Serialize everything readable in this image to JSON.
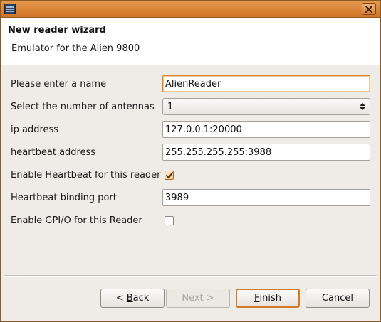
{
  "window": {
    "close_icon": "close-icon",
    "app_icon": "reader-app-icon"
  },
  "header": {
    "title": "New reader wizard",
    "subtitle": "Emulator for the Alien 9800"
  },
  "form": {
    "name": {
      "label": "Please enter a name",
      "value": "AlienReader"
    },
    "antennas": {
      "label": "Select the number of antennas",
      "value": "1"
    },
    "ip": {
      "label": "ip address",
      "value": "127.0.0.1:20000"
    },
    "heartbeat_address": {
      "label": "heartbeat address",
      "value": "255.255.255.255:3988"
    },
    "enable_heartbeat": {
      "label": "Enable Heartbeat for this reader",
      "checked": true
    },
    "heartbeat_port": {
      "label": "Heartbeat binding port",
      "value": "3989"
    },
    "enable_gpio": {
      "label": "Enable GPI/O for this Reader",
      "checked": false
    }
  },
  "buttons": {
    "back": {
      "prefix": "< ",
      "mnemonic": "B",
      "rest": "ack"
    },
    "next": {
      "label": "Next >"
    },
    "finish": {
      "mnemonic": "F",
      "rest": "inish"
    },
    "cancel": {
      "label": "Cancel"
    }
  },
  "colors": {
    "titlebar": "#d9833a",
    "focus_accent": "#d6822f",
    "dialog_bg": "#efebe7"
  }
}
